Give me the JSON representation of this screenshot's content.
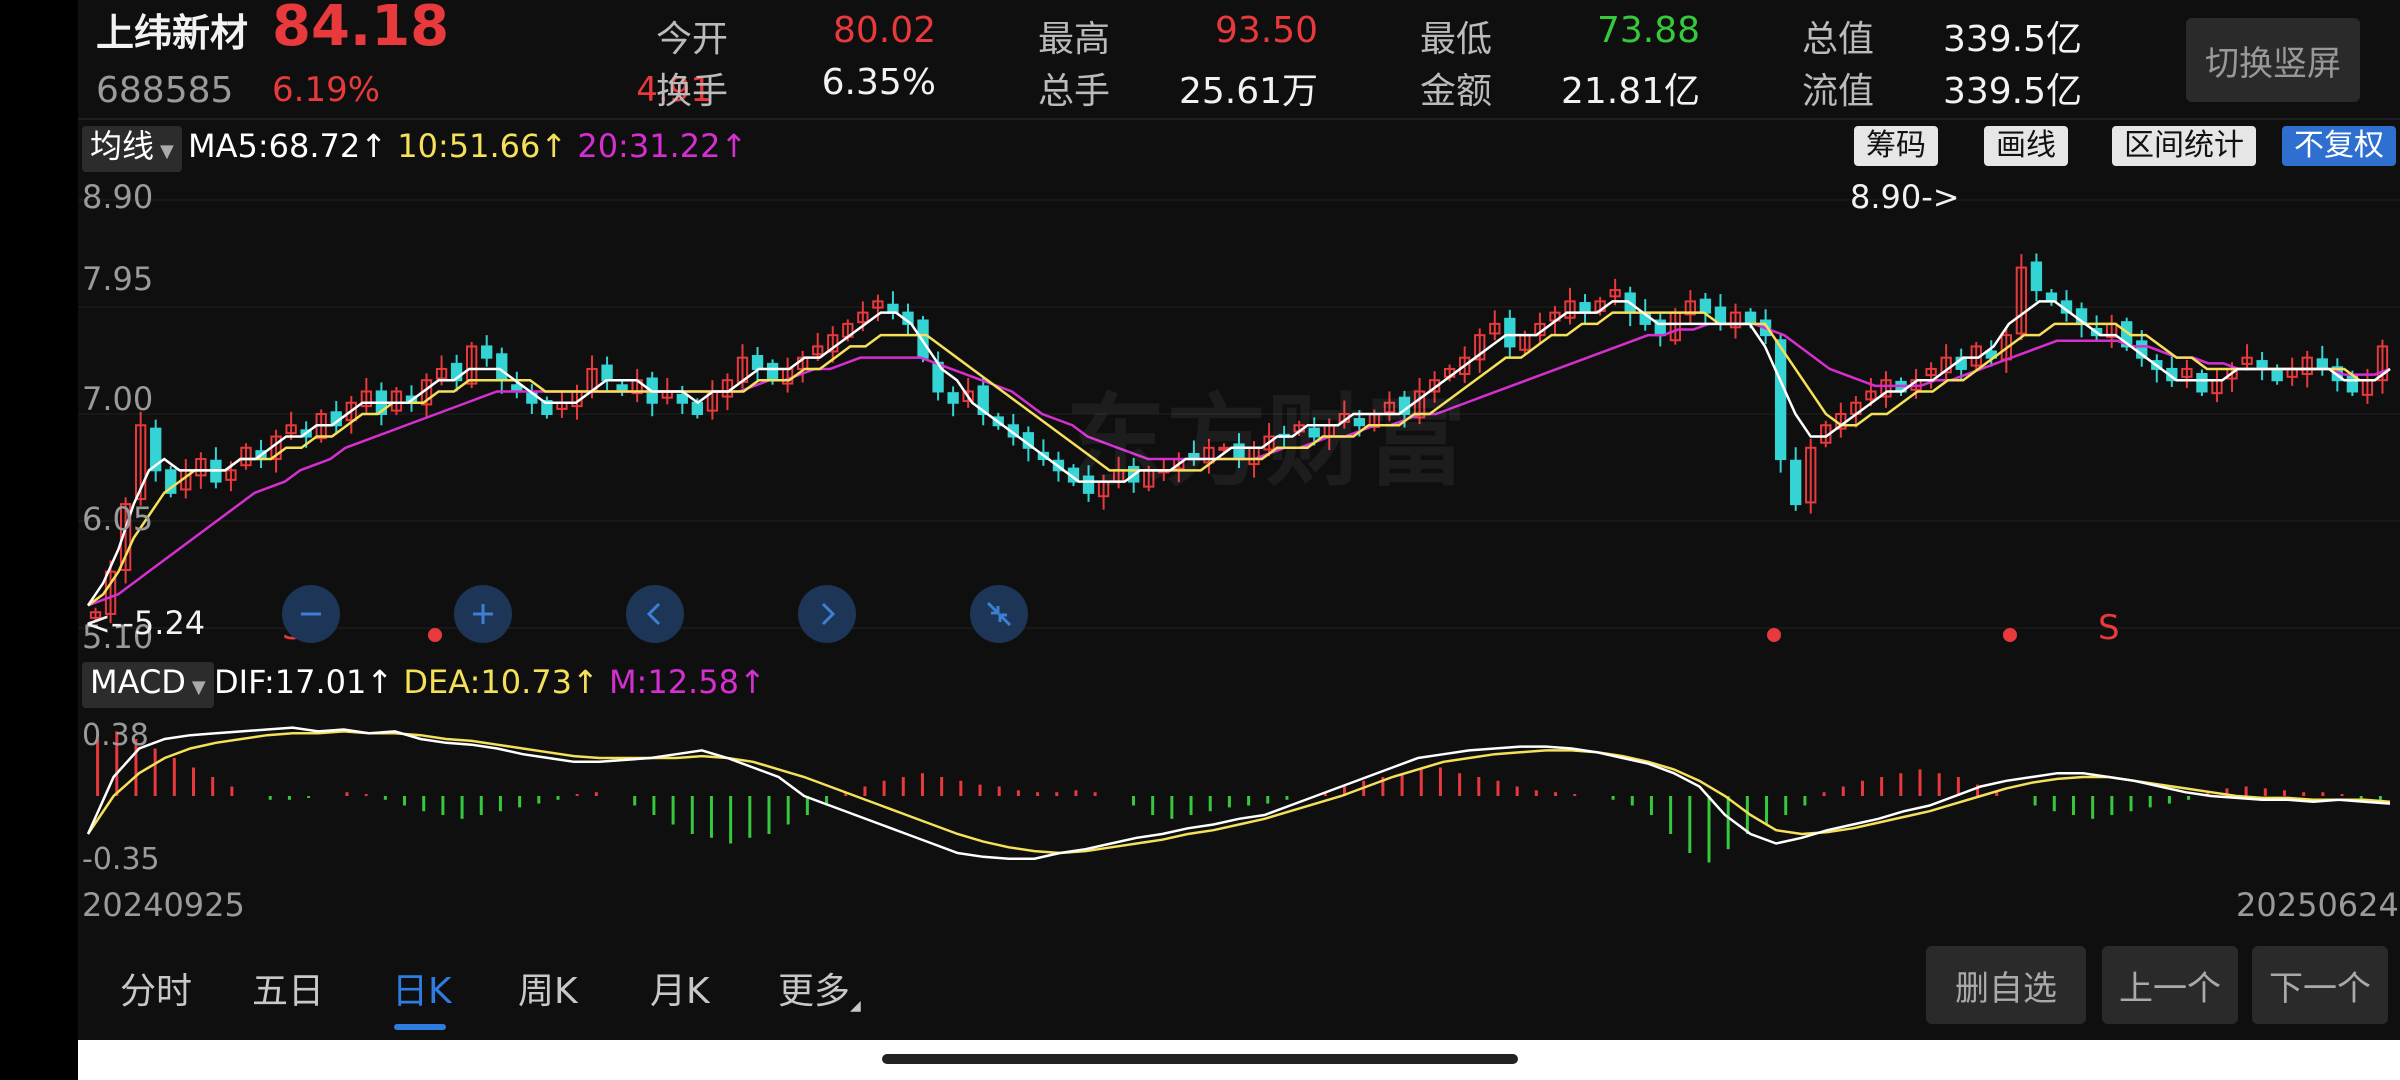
{
  "header": {
    "stock_name": "上纬新材",
    "price": "84.18",
    "code": "688585",
    "change_pct": "6.19%",
    "change_amt": "4.91",
    "switch_button": "切换竖屏",
    "fields": [
      {
        "label": "今开",
        "value": "80.02",
        "color": "#e8393c"
      },
      {
        "label": "最高",
        "value": "93.50",
        "color": "#e8393c"
      },
      {
        "label": "最低",
        "value": "73.88",
        "color": "#35c93b"
      },
      {
        "label": "总值",
        "value": "339.5亿",
        "color": "#f2f2f2"
      },
      {
        "label": "换手",
        "value": "6.35%",
        "color": "#f2f2f2"
      },
      {
        "label": "总手",
        "value": "25.61万",
        "color": "#f2f2f2"
      },
      {
        "label": "金额",
        "value": "21.81亿",
        "color": "#f2f2f2"
      },
      {
        "label": "流值",
        "value": "339.5亿",
        "color": "#f2f2f2"
      }
    ]
  },
  "ma_bar": {
    "selector": "均线",
    "ma5": "MA5:68.72",
    "ma10": "10:51.66",
    "ma20": "20:31.22",
    "arrow": "↑",
    "buttons": [
      "筹码",
      "画线",
      "区间统计",
      "不复权"
    ]
  },
  "kline": {
    "y_labels": [
      "8.90",
      "7.95",
      "7.00",
      "6.05",
      "5.10"
    ],
    "max_annotation": "8.90->",
    "min_annotation": "<--5.24",
    "signals": [
      "S",
      "S"
    ],
    "watermark": "东方财富"
  },
  "macd_bar": {
    "selector": "MACD",
    "dif": "DIF:17.01",
    "dea": "DEA:10.73",
    "m": "M:12.58",
    "arrow": "↑",
    "y_labels": [
      "0.38",
      "-0.35"
    ]
  },
  "dates": {
    "start": "20240925",
    "end": "20250624"
  },
  "tabs": [
    {
      "label": "分时",
      "active": false
    },
    {
      "label": "五日",
      "active": false
    },
    {
      "label": "日K",
      "active": true
    },
    {
      "label": "周K",
      "active": false
    },
    {
      "label": "月K",
      "active": false
    },
    {
      "label": "更多",
      "active": false
    }
  ],
  "bottom_buttons": [
    "删自选",
    "上一个",
    "下一个"
  ],
  "colors": {
    "up": "#e8393c",
    "down": "#35d4d4",
    "ma5": "#ffffff",
    "ma10": "#f5e05a",
    "ma20": "#d52fd0",
    "macd_pos": "#e8393c",
    "macd_neg": "#35c93b",
    "active_tab": "#2f7de1"
  },
  "chart_data": {
    "type": "candlestick",
    "y_range": [
      5.1,
      8.9
    ],
    "closes": [
      5.24,
      5.6,
      6.2,
      6.9,
      6.5,
      6.3,
      6.5,
      6.6,
      6.4,
      6.5,
      6.7,
      6.6,
      6.8,
      6.9,
      6.8,
      7.0,
      6.9,
      7.1,
      7.2,
      7.0,
      7.2,
      7.1,
      7.3,
      7.4,
      7.3,
      7.6,
      7.5,
      7.3,
      7.2,
      7.1,
      7.0,
      7.1,
      7.2,
      7.4,
      7.3,
      7.2,
      7.3,
      7.1,
      7.2,
      7.1,
      7.0,
      7.2,
      7.3,
      7.5,
      7.4,
      7.3,
      7.4,
      7.5,
      7.6,
      7.7,
      7.8,
      7.9,
      8.0,
      7.9,
      7.8,
      7.5,
      7.2,
      7.1,
      7.2,
      7.0,
      6.9,
      6.8,
      6.7,
      6.6,
      6.5,
      6.4,
      6.3,
      6.4,
      6.5,
      6.4,
      6.5,
      6.5,
      6.6,
      6.6,
      6.7,
      6.7,
      6.6,
      6.7,
      6.8,
      6.8,
      6.9,
      6.8,
      6.9,
      7.0,
      6.9,
      7.0,
      7.1,
      7.0,
      7.2,
      7.3,
      7.4,
      7.5,
      7.7,
      7.8,
      7.6,
      7.7,
      7.8,
      7.9,
      8.0,
      7.9,
      8.0,
      8.1,
      7.9,
      7.8,
      7.7,
      7.9,
      8.0,
      7.9,
      7.8,
      7.9,
      7.8,
      7.7,
      6.6,
      6.2,
      6.7,
      6.9,
      7.0,
      7.1,
      7.2,
      7.3,
      7.2,
      7.3,
      7.4,
      7.5,
      7.4,
      7.6,
      7.5,
      7.7,
      8.3,
      8.1,
      8.0,
      7.9,
      7.8,
      7.7,
      7.8,
      7.6,
      7.5,
      7.4,
      7.3,
      7.4,
      7.2,
      7.3,
      7.4,
      7.5,
      7.4,
      7.3,
      7.4,
      7.5,
      7.4,
      7.3,
      7.2,
      7.3,
      7.6
    ],
    "ma5": [
      5.3,
      5.5,
      5.8,
      6.2,
      6.5,
      6.6,
      6.5,
      6.5,
      6.5,
      6.5,
      6.6,
      6.6,
      6.7,
      6.8,
      6.8,
      6.9,
      6.9,
      7.0,
      7.1,
      7.1,
      7.1,
      7.1,
      7.2,
      7.3,
      7.3,
      7.4,
      7.4,
      7.4,
      7.3,
      7.2,
      7.1,
      7.1,
      7.1,
      7.2,
      7.3,
      7.3,
      7.3,
      7.2,
      7.2,
      7.2,
      7.1,
      7.2,
      7.2,
      7.3,
      7.4,
      7.4,
      7.4,
      7.5,
      7.5,
      7.6,
      7.7,
      7.8,
      7.9,
      7.9,
      7.8,
      7.6,
      7.4,
      7.3,
      7.1,
      7.0,
      6.9,
      6.8,
      6.7,
      6.6,
      6.5,
      6.4,
      6.4,
      6.4,
      6.4,
      6.5,
      6.5,
      6.5,
      6.6,
      6.6,
      6.6,
      6.7,
      6.7,
      6.7,
      6.8,
      6.8,
      6.9,
      6.9,
      6.9,
      7.0,
      7.0,
      7.0,
      7.0,
      7.1,
      7.2,
      7.3,
      7.4,
      7.5,
      7.6,
      7.7,
      7.7,
      7.7,
      7.8,
      7.9,
      7.9,
      7.9,
      8.0,
      8.0,
      7.9,
      7.8,
      7.8,
      7.8,
      7.8,
      7.8,
      7.8,
      7.8,
      7.6,
      7.3,
      7.0,
      6.8,
      6.8,
      6.9,
      7.0,
      7.1,
      7.2,
      7.2,
      7.3,
      7.3,
      7.4,
      7.5,
      7.5,
      7.6,
      7.8,
      7.9,
      8.0,
      8.0,
      7.9,
      7.8,
      7.7,
      7.7,
      7.6,
      7.5,
      7.4,
      7.3,
      7.3,
      7.3,
      7.3,
      7.4,
      7.4,
      7.4,
      7.4,
      7.4,
      7.4,
      7.4,
      7.3,
      7.3,
      7.3,
      7.4
    ],
    "ma10": [
      5.3,
      5.4,
      5.6,
      5.9,
      6.1,
      6.3,
      6.4,
      6.5,
      6.5,
      6.5,
      6.6,
      6.6,
      6.6,
      6.7,
      6.7,
      6.8,
      6.8,
      6.9,
      7.0,
      7.0,
      7.1,
      7.1,
      7.1,
      7.2,
      7.2,
      7.3,
      7.3,
      7.3,
      7.3,
      7.3,
      7.2,
      7.2,
      7.2,
      7.2,
      7.2,
      7.2,
      7.2,
      7.2,
      7.2,
      7.2,
      7.2,
      7.2,
      7.2,
      7.2,
      7.3,
      7.3,
      7.3,
      7.4,
      7.4,
      7.5,
      7.6,
      7.6,
      7.7,
      7.7,
      7.7,
      7.7,
      7.6,
      7.5,
      7.4,
      7.3,
      7.2,
      7.1,
      7.0,
      6.9,
      6.8,
      6.7,
      6.6,
      6.5,
      6.5,
      6.5,
      6.5,
      6.5,
      6.5,
      6.5,
      6.6,
      6.6,
      6.6,
      6.6,
      6.7,
      6.7,
      6.7,
      6.8,
      6.8,
      6.8,
      6.9,
      6.9,
      6.9,
      7.0,
      7.0,
      7.1,
      7.2,
      7.3,
      7.4,
      7.5,
      7.5,
      7.6,
      7.7,
      7.7,
      7.8,
      7.8,
      7.9,
      7.9,
      7.9,
      7.9,
      7.9,
      7.9,
      7.9,
      7.8,
      7.8,
      7.8,
      7.8,
      7.6,
      7.4,
      7.2,
      7.0,
      6.9,
      6.9,
      7.0,
      7.0,
      7.1,
      7.2,
      7.2,
      7.3,
      7.3,
      7.4,
      7.5,
      7.6,
      7.7,
      7.7,
      7.8,
      7.8,
      7.8,
      7.8,
      7.8,
      7.7,
      7.7,
      7.6,
      7.5,
      7.5,
      7.4,
      7.4,
      7.4,
      7.4,
      7.4,
      7.4,
      7.4,
      7.4,
      7.4,
      7.4,
      7.3,
      7.3,
      7.4
    ],
    "ma20": [
      5.3,
      5.35,
      5.4,
      5.5,
      5.6,
      5.7,
      5.8,
      5.9,
      6.0,
      6.1,
      6.2,
      6.3,
      6.35,
      6.4,
      6.5,
      6.55,
      6.6,
      6.7,
      6.75,
      6.8,
      6.85,
      6.9,
      6.95,
      7.0,
      7.05,
      7.1,
      7.15,
      7.2,
      7.2,
      7.2,
      7.2,
      7.2,
      7.2,
      7.2,
      7.2,
      7.2,
      7.2,
      7.2,
      7.2,
      7.2,
      7.2,
      7.2,
      7.2,
      7.2,
      7.25,
      7.3,
      7.3,
      7.35,
      7.4,
      7.4,
      7.45,
      7.5,
      7.5,
      7.5,
      7.5,
      7.5,
      7.45,
      7.4,
      7.35,
      7.3,
      7.25,
      7.2,
      7.1,
      7.0,
      6.95,
      6.9,
      6.8,
      6.75,
      6.7,
      6.65,
      6.6,
      6.6,
      6.6,
      6.6,
      6.6,
      6.6,
      6.6,
      6.6,
      6.65,
      6.7,
      6.7,
      6.75,
      6.8,
      6.8,
      6.85,
      6.9,
      6.9,
      6.95,
      7.0,
      7.0,
      7.05,
      7.1,
      7.15,
      7.2,
      7.25,
      7.3,
      7.35,
      7.4,
      7.45,
      7.5,
      7.55,
      7.6,
      7.65,
      7.7,
      7.7,
      7.75,
      7.75,
      7.8,
      7.8,
      7.8,
      7.8,
      7.75,
      7.7,
      7.6,
      7.5,
      7.4,
      7.35,
      7.3,
      7.25,
      7.25,
      7.25,
      7.25,
      7.3,
      7.3,
      7.35,
      7.4,
      7.45,
      7.5,
      7.55,
      7.6,
      7.65,
      7.65,
      7.65,
      7.65,
      7.65,
      7.6,
      7.6,
      7.55,
      7.5,
      7.5,
      7.45,
      7.45,
      7.4,
      7.4,
      7.4,
      7.4,
      7.4,
      7.4,
      7.4,
      7.35,
      7.35,
      7.35,
      7.4
    ],
    "macd_hist": [
      0.3,
      0.34,
      0.3,
      0.25,
      0.2,
      0.15,
      0.1,
      0.05,
      0.0,
      -0.02,
      -0.02,
      -0.01,
      0.0,
      0.02,
      0.01,
      -0.02,
      -0.05,
      -0.08,
      -0.1,
      -0.12,
      -0.1,
      -0.08,
      -0.06,
      -0.04,
      -0.02,
      0.01,
      0.02,
      0.0,
      -0.05,
      -0.1,
      -0.15,
      -0.2,
      -0.22,
      -0.25,
      -0.22,
      -0.2,
      -0.15,
      -0.1,
      -0.05,
      0.02,
      0.05,
      0.08,
      0.1,
      0.12,
      0.1,
      0.08,
      0.06,
      0.05,
      0.03,
      0.02,
      0.02,
      0.03,
      0.02,
      0.0,
      -0.05,
      -0.1,
      -0.12,
      -0.1,
      -0.08,
      -0.06,
      -0.05,
      -0.04,
      -0.02,
      0.0,
      0.02,
      0.05,
      0.08,
      0.1,
      0.12,
      0.14,
      0.15,
      0.12,
      0.1,
      0.08,
      0.05,
      0.03,
      0.02,
      0.01,
      0.0,
      -0.02,
      -0.05,
      -0.1,
      -0.2,
      -0.3,
      -0.35,
      -0.28,
      -0.2,
      -0.15,
      -0.1,
      -0.05,
      0.02,
      0.05,
      0.08,
      0.1,
      0.12,
      0.14,
      0.12,
      0.1,
      0.06,
      0.03,
      0.0,
      -0.05,
      -0.08,
      -0.1,
      -0.12,
      -0.1,
      -0.08,
      -0.06,
      -0.04,
      -0.02,
      0.02,
      0.04,
      0.05,
      0.04,
      0.03,
      0.02,
      0.02,
      0.01,
      -0.02,
      -0.04
    ],
    "dif": [
      -0.2,
      0.1,
      0.25,
      0.3,
      0.32,
      0.33,
      0.34,
      0.35,
      0.36,
      0.34,
      0.35,
      0.33,
      0.34,
      0.3,
      0.28,
      0.27,
      0.25,
      0.22,
      0.2,
      0.18,
      0.18,
      0.19,
      0.2,
      0.22,
      0.24,
      0.2,
      0.15,
      0.1,
      0.0,
      -0.05,
      -0.1,
      -0.15,
      -0.2,
      -0.25,
      -0.3,
      -0.32,
      -0.33,
      -0.33,
      -0.3,
      -0.28,
      -0.25,
      -0.22,
      -0.2,
      -0.17,
      -0.15,
      -0.12,
      -0.1,
      -0.05,
      0.0,
      0.05,
      0.1,
      0.15,
      0.2,
      0.22,
      0.24,
      0.25,
      0.26,
      0.26,
      0.25,
      0.23,
      0.2,
      0.17,
      0.12,
      0.05,
      -0.1,
      -0.2,
      -0.25,
      -0.22,
      -0.18,
      -0.15,
      -0.12,
      -0.08,
      -0.05,
      0.0,
      0.05,
      0.08,
      0.1,
      0.12,
      0.12,
      0.1,
      0.08,
      0.05,
      0.02,
      0.0,
      -0.01,
      -0.02,
      -0.02,
      -0.03,
      -0.02,
      -0.03,
      -0.04
    ],
    "dea": [
      -0.2,
      0.0,
      0.12,
      0.2,
      0.25,
      0.28,
      0.3,
      0.32,
      0.33,
      0.33,
      0.34,
      0.33,
      0.33,
      0.32,
      0.3,
      0.29,
      0.27,
      0.25,
      0.23,
      0.21,
      0.2,
      0.2,
      0.2,
      0.2,
      0.21,
      0.2,
      0.18,
      0.14,
      0.1,
      0.05,
      0.0,
      -0.05,
      -0.1,
      -0.15,
      -0.2,
      -0.24,
      -0.27,
      -0.29,
      -0.3,
      -0.29,
      -0.27,
      -0.25,
      -0.23,
      -0.2,
      -0.18,
      -0.15,
      -0.12,
      -0.08,
      -0.04,
      0.0,
      0.05,
      0.1,
      0.14,
      0.18,
      0.2,
      0.22,
      0.23,
      0.24,
      0.24,
      0.23,
      0.21,
      0.18,
      0.14,
      0.08,
      0.0,
      -0.1,
      -0.18,
      -0.2,
      -0.19,
      -0.17,
      -0.14,
      -0.11,
      -0.08,
      -0.04,
      0.0,
      0.04,
      0.07,
      0.09,
      0.1,
      0.1,
      0.08,
      0.06,
      0.04,
      0.02,
      0.0,
      -0.01,
      -0.01,
      -0.02,
      -0.02,
      -0.02,
      -0.03
    ]
  }
}
